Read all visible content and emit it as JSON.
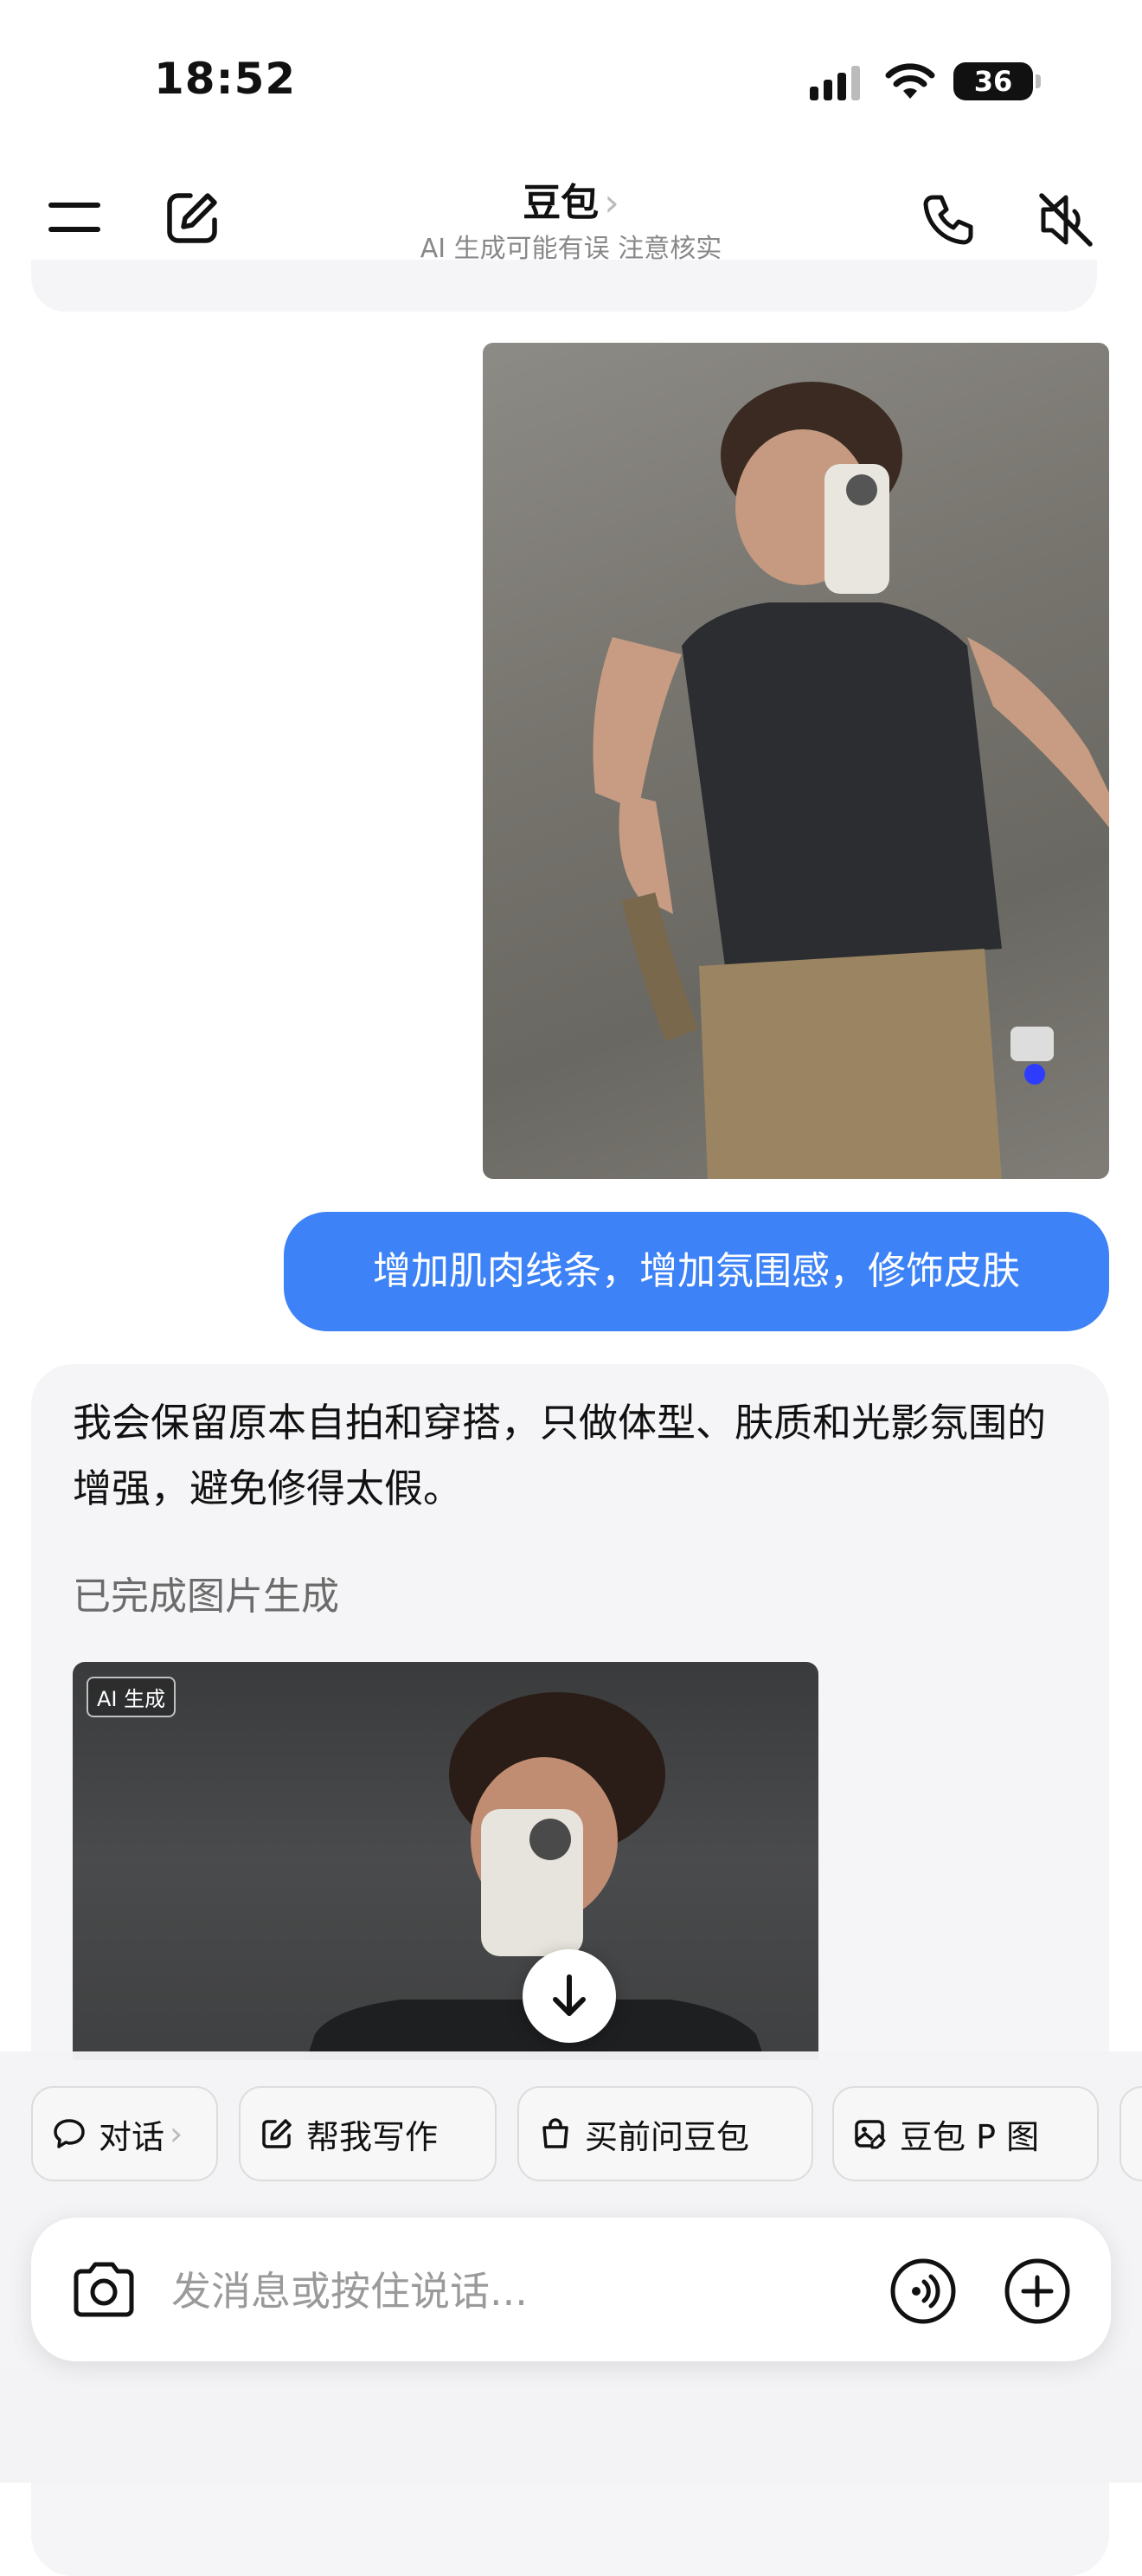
{
  "status_bar": {
    "time": "18:52",
    "battery": "36"
  },
  "header": {
    "title": "豆包",
    "title_chevron": "›",
    "subtitle": "AI 生成可能有误 注意核实"
  },
  "conversation": {
    "user_message": "增加肌肉线条，增加氛围感，修饰皮肤",
    "ai_message": "我会保留原本自拍和穿搭，只做体型、肤质和光影氛围的增强，避免修得太假。",
    "ai_status": "已完成图片生成",
    "ai_image_badge": "AI 生成"
  },
  "quick_actions": [
    {
      "label": "对话",
      "icon": "chat-bubble-icon"
    },
    {
      "label": "帮我写作",
      "icon": "edit-icon"
    },
    {
      "label": "买前问豆包",
      "icon": "shopping-bag-icon"
    },
    {
      "label": "豆包 P 图",
      "icon": "image-edit-icon"
    }
  ],
  "input": {
    "placeholder": "发消息或按住说话..."
  },
  "colors": {
    "accent": "#3d82f6",
    "bubble_bg": "#f5f5f7"
  }
}
